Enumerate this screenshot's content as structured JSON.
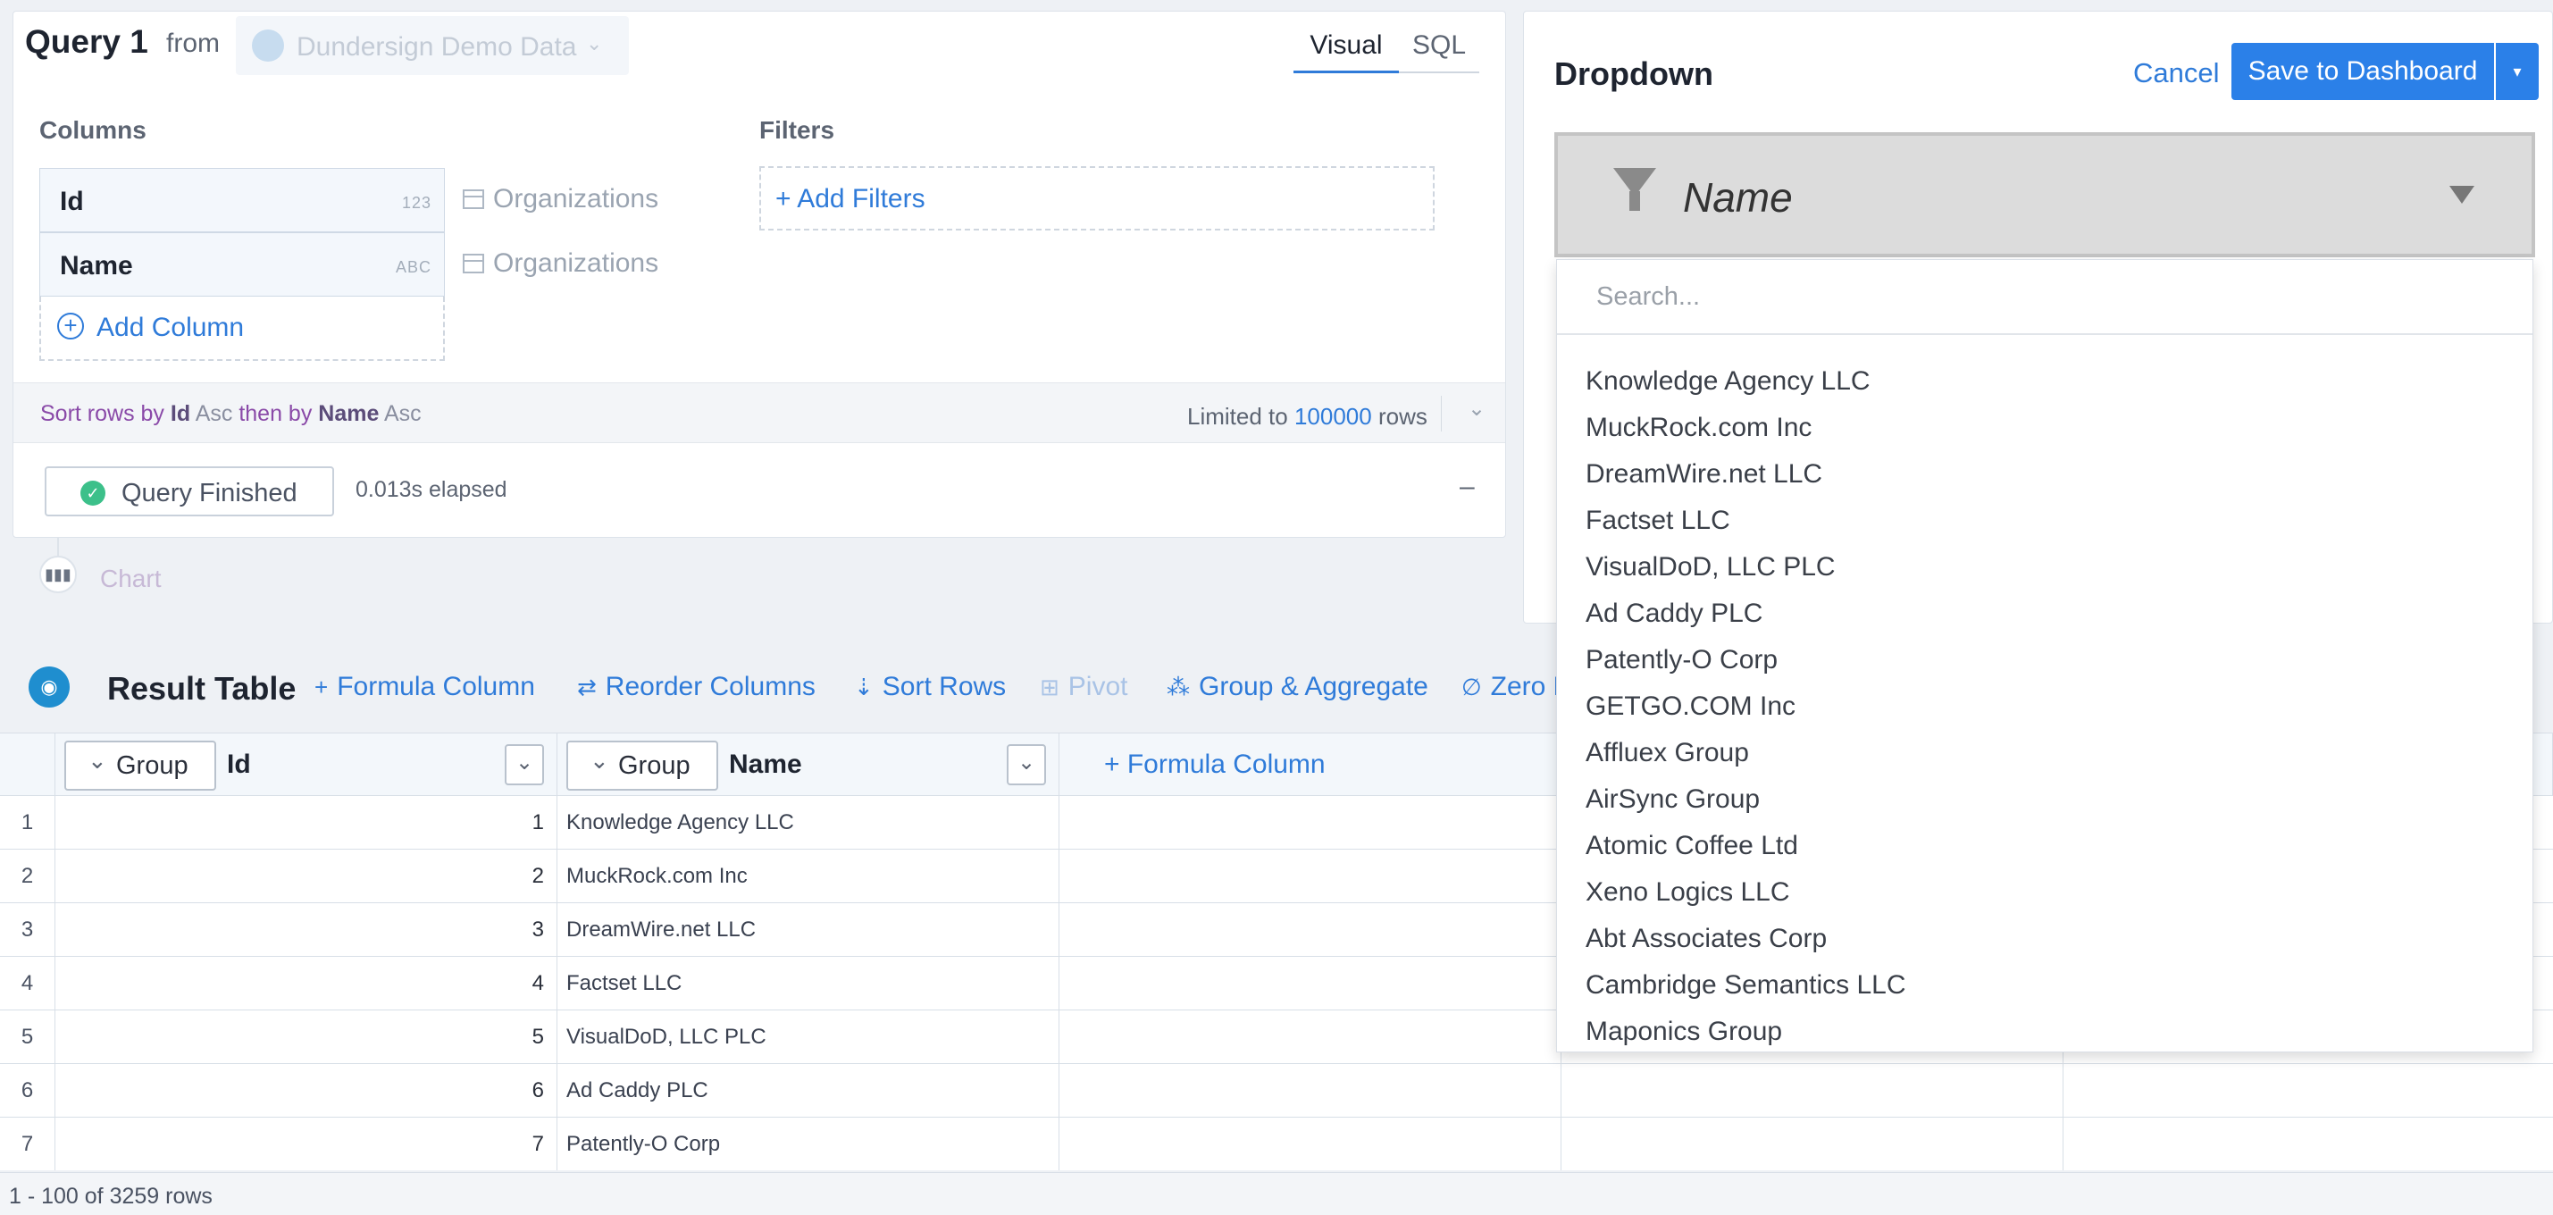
{
  "query": {
    "title": "Query 1",
    "from_label": "from",
    "datasource": "Dundersign Demo Data",
    "tabs": [
      "Visual",
      "SQL"
    ],
    "columns_label": "Columns",
    "filters_label": "Filters",
    "columns": [
      {
        "name": "Id",
        "type": "123",
        "source": "Organizations"
      },
      {
        "name": "Name",
        "type": "ABC",
        "source": "Organizations"
      }
    ],
    "add_column": "Add Column",
    "add_filters": "+ Add Filters",
    "sort": {
      "prefix": "Sort rows by",
      "col1": "Id",
      "dir1": "Asc",
      "then_by": "then by",
      "col2": "Name",
      "dir2": "Asc"
    },
    "limit": {
      "prefix": "Limited to",
      "value": "100000",
      "suffix": "rows"
    },
    "status": "Query Finished",
    "elapsed": "0.013s elapsed",
    "collapse": "–",
    "chart_label": "Chart"
  },
  "dropdown": {
    "title": "Dropdown",
    "cancel": "Cancel",
    "save": "Save to Dashboard",
    "selected": "Name",
    "search_placeholder": "Search...",
    "options": [
      "Knowledge Agency LLC",
      "MuckRock.com Inc",
      "DreamWire.net LLC",
      "Factset LLC",
      "VisualDoD, LLC PLC",
      "Ad Caddy PLC",
      "Patently-O Corp",
      "GETGO.COM Inc",
      "Affluex Group",
      "AirSync Group",
      "Atomic Coffee Ltd",
      "Xeno Logics LLC",
      "Abt Associates Corp",
      "Cambridge Semantics LLC",
      "Maponics Group"
    ]
  },
  "result": {
    "title": "Result Table",
    "toolbar": {
      "formula_column": "Formula Column",
      "reorder_columns": "Reorder Columns",
      "sort_rows": "Sort Rows",
      "pivot": "Pivot",
      "group_aggregate": "Group & Aggregate",
      "zero_fill": "Zero F"
    },
    "headers": {
      "group": "Group",
      "id": "Id",
      "name": "Name",
      "formula_column": "+ Formula Column"
    },
    "rows": [
      {
        "n": "1",
        "id": "1",
        "name": "Knowledge Agency LLC"
      },
      {
        "n": "2",
        "id": "2",
        "name": "MuckRock.com Inc"
      },
      {
        "n": "3",
        "id": "3",
        "name": "DreamWire.net LLC"
      },
      {
        "n": "4",
        "id": "4",
        "name": "Factset LLC"
      },
      {
        "n": "5",
        "id": "5",
        "name": "VisualDoD, LLC PLC"
      },
      {
        "n": "6",
        "id": "6",
        "name": "Ad Caddy PLC"
      },
      {
        "n": "7",
        "id": "7",
        "name": "Patently-O Corp"
      }
    ],
    "row_count": "1 - 100 of 3259 rows"
  },
  "colors": {
    "accent": "#2f7bd9",
    "save_button": "#2b80e8",
    "success": "#3cc08a"
  }
}
